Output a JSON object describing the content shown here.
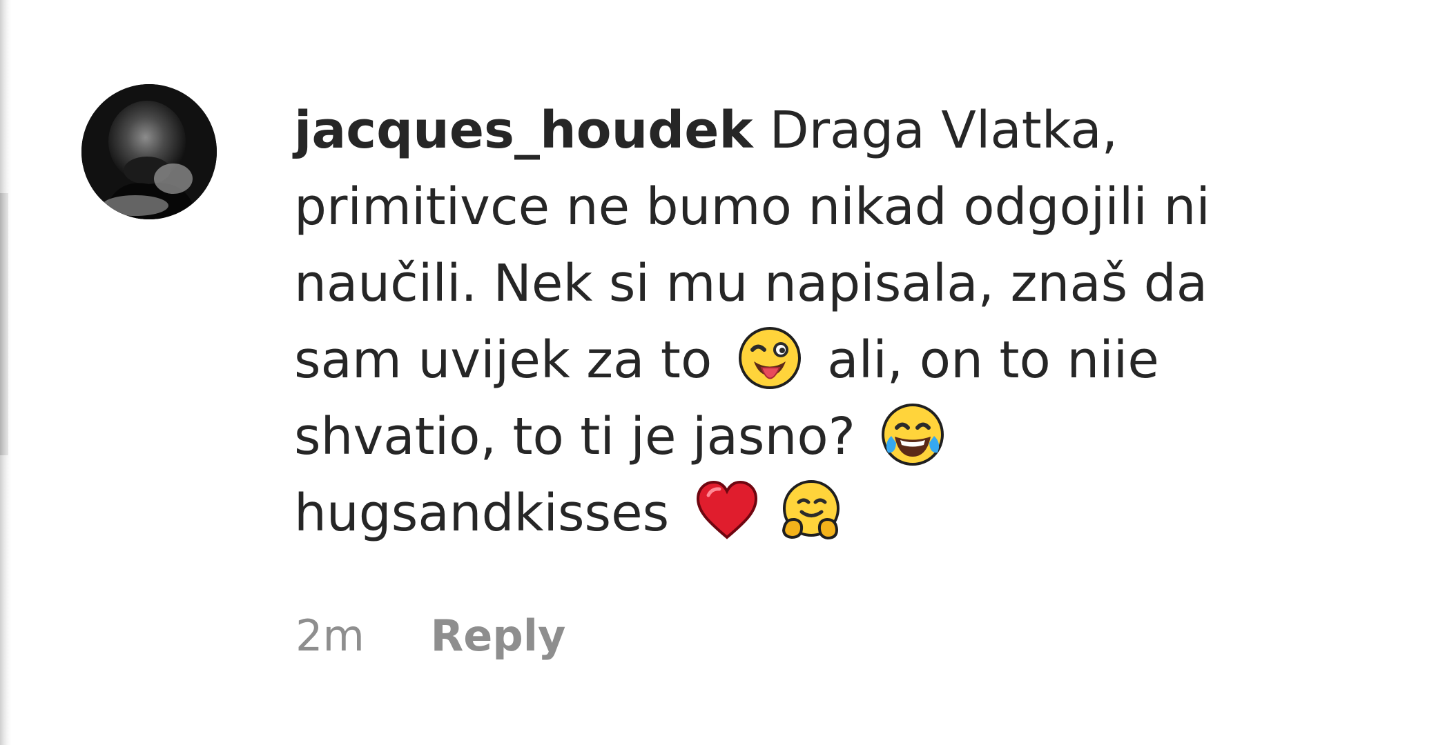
{
  "comment": {
    "username": "jacques_houdek",
    "text_parts": [
      "Draga Vlatka, primitivce ne bumo nikad odgojili ni naučili. Nek si mu napisala, znaš da sam uvijek za to",
      "ali, on to niie shvatio, to ti je jasno?",
      "hugsandkisses"
    ],
    "emojis": [
      {
        "name": "winking-face-with-tongue-icon",
        "glyph": "😜"
      },
      {
        "name": "face-with-tears-of-joy-icon",
        "glyph": "😂"
      },
      {
        "name": "red-heart-icon",
        "glyph": "❤️"
      },
      {
        "name": "hugging-face-icon",
        "glyph": "🤗"
      }
    ],
    "timestamp": "2m",
    "reply_label": "Reply"
  },
  "colors": {
    "text": "#262626",
    "secondary_text": "#8e8e8e",
    "background": "#ffffff"
  }
}
